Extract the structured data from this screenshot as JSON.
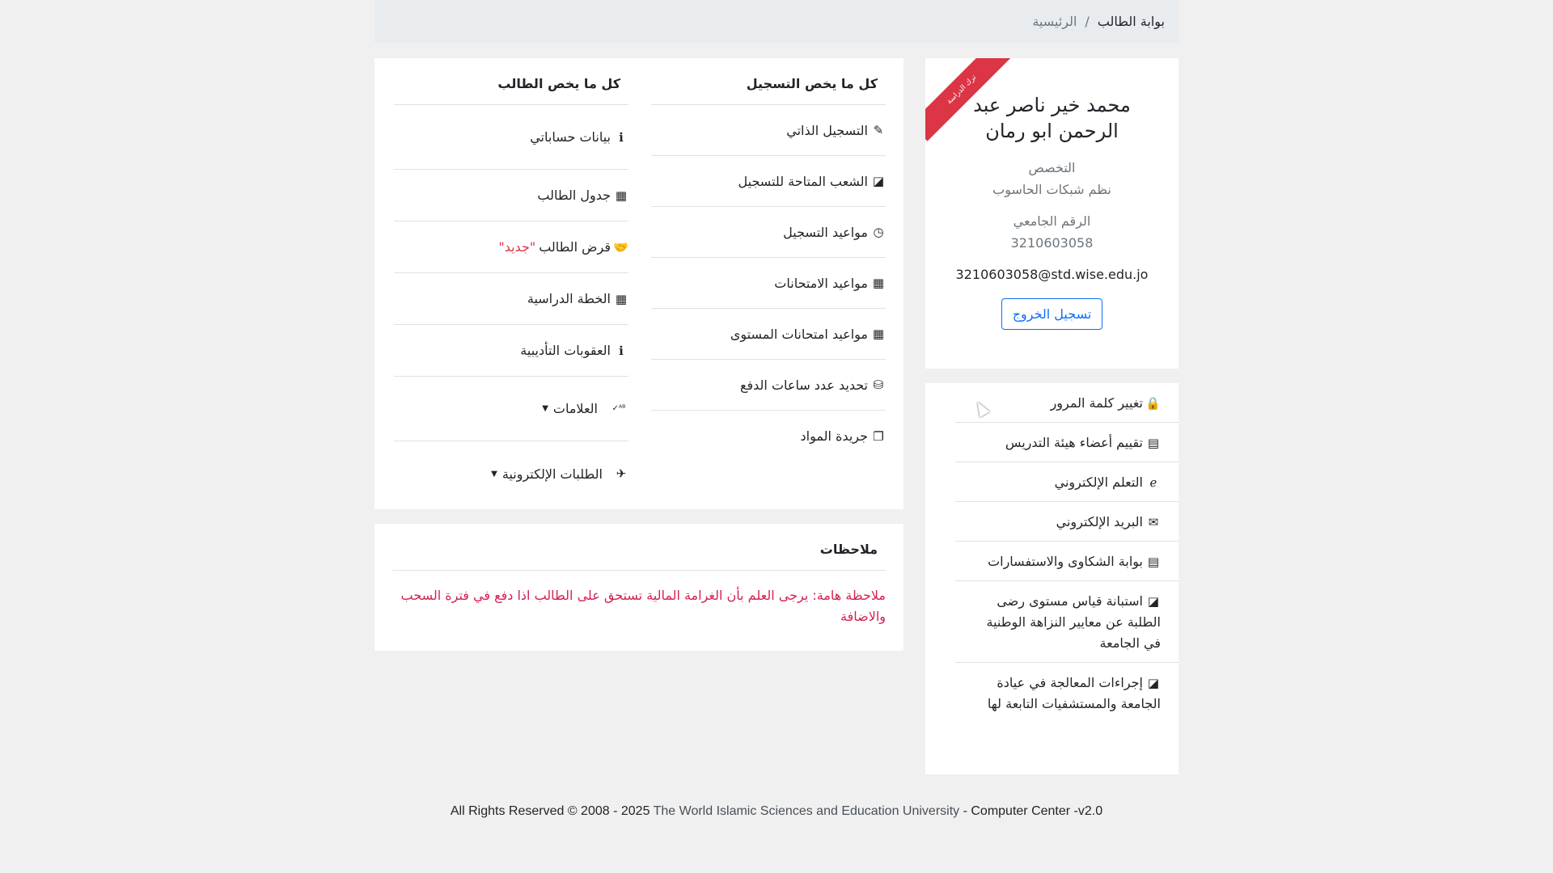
{
  "breadcrumb": {
    "active": "بوابة الطالب",
    "separator": "/",
    "home": "الرئيسية"
  },
  "profile": {
    "ribbon": "ترك الدراسة",
    "name": "محمد خير ناصر عبد الرحمن ابو رمان",
    "specialization_label": "التخصص",
    "specialization_value": "نظم شبكات الحاسوب",
    "student_id_label": "الرقم الجامعي",
    "student_id_value": "3210603058",
    "email": "3210603058@std.wise.edu.jo",
    "logout_label": "تسجيل الخروج"
  },
  "side_links": [
    {
      "label": "تغيير كلمة المرور",
      "icon": "lock-icon",
      "glyph": "🔒"
    },
    {
      "label": "تقييم أعضاء هيئة التدريس",
      "icon": "id-card-icon",
      "glyph": "▤"
    },
    {
      "label": "التعلم الإلكتروني",
      "icon": "internet-explorer-icon",
      "glyph": "ℯ"
    },
    {
      "label": "البريد الإلكتروني",
      "icon": "envelope-icon",
      "glyph": "✉"
    },
    {
      "label": "بوابة الشكاوى والاستفسارات",
      "icon": "id-card-icon",
      "glyph": "▤"
    },
    {
      "label": "استبانة قياس مستوى رضى الطلبة عن معايير النزاهة الوطنية في الجامعة",
      "icon": "sticky-note-icon",
      "glyph": "◪"
    },
    {
      "label": "إجراءات المعالجة في عيادة الجامعة والمستشفيات التابعة لها",
      "icon": "sticky-note-icon",
      "glyph": "◪"
    }
  ],
  "registration": {
    "title": "كل ما يخص التسجيل",
    "items": [
      {
        "label": "التسجيل الذاتي",
        "icon": "pencil-icon",
        "glyph": "✎"
      },
      {
        "label": "الشعب المتاحة للتسجيل",
        "icon": "sticky-note-icon",
        "glyph": "◪"
      },
      {
        "label": "مواعيد التسجيل",
        "icon": "clock-icon",
        "glyph": "◷"
      },
      {
        "label": "مواعيد الامتحانات",
        "icon": "calendar-icon",
        "glyph": "▦"
      },
      {
        "label": "مواعيد امتحانات المستوى",
        "icon": "calendar-icon",
        "glyph": "▦"
      },
      {
        "label": "تحديد عدد ساعات الدفع",
        "icon": "coins-icon",
        "glyph": "⛁"
      },
      {
        "label": "جريدة المواد",
        "icon": "copy-icon",
        "glyph": "❐"
      }
    ]
  },
  "student": {
    "title": "كل ما يخص الطالب",
    "items": [
      {
        "label": "بيانات حساباتي",
        "icon": "info-icon",
        "glyph": "ℹ"
      },
      {
        "label": "جدول الطالب",
        "icon": "table-icon",
        "glyph": "▦"
      },
      {
        "label": "قرض الطالب",
        "icon": "handshake-icon",
        "glyph": "🤝",
        "badge": "\"جديد\""
      },
      {
        "label": "الخطة الدراسية",
        "icon": "solar-panel-icon",
        "glyph": "▦"
      },
      {
        "label": "العقوبات التأديبية",
        "icon": "info-icon",
        "glyph": "ℹ"
      },
      {
        "label": "العلامات",
        "icon": "spell-check-icon",
        "glyph": "ᴬᴮ✓",
        "caret": "▼"
      },
      {
        "label": "الطلبات الإلكترونية",
        "icon": "paper-plane-icon",
        "glyph": "✈",
        "caret": "▼"
      }
    ]
  },
  "notes": {
    "title": "ملاحظات",
    "text": "ملاحظة هامة: يرجى العلم بأن الغرامة المالية تستحق على الطالب اذا دفع في فترة السحب والاضافة"
  },
  "footer": {
    "prefix": "All Rights Reserved © 2008 - 2025 ",
    "university": "The World Islamic Sciences and Education University",
    "suffix": " - Computer Center -v2.0"
  },
  "colors": {
    "accent": "#0d6efd",
    "danger": "#dc3545",
    "note": "#d6204f",
    "background": "#f0f0f0"
  }
}
